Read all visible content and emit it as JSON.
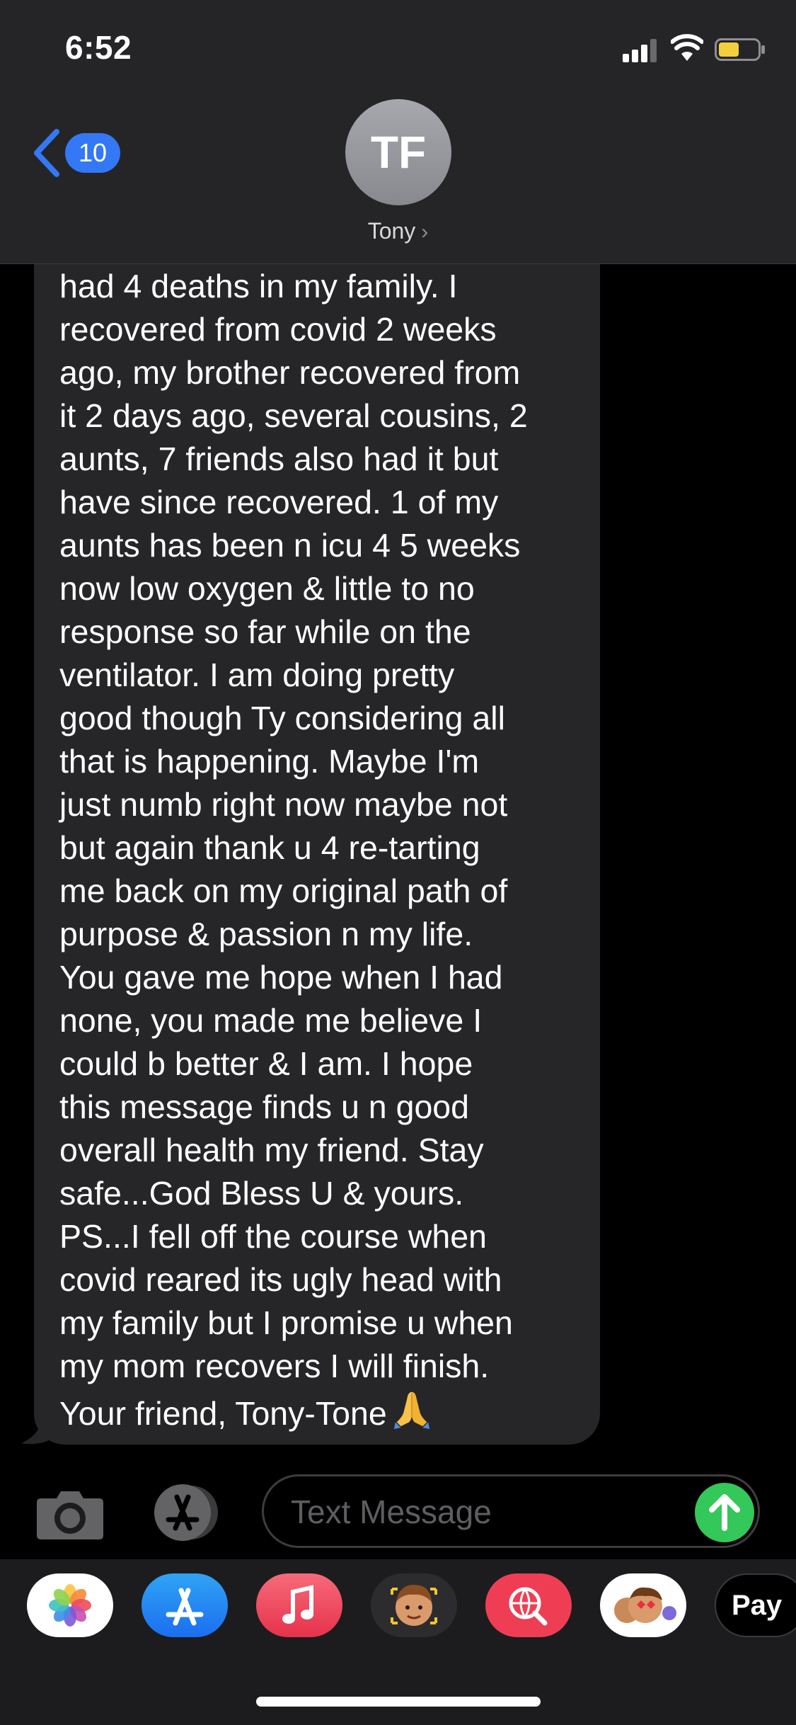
{
  "status_bar": {
    "time": "6:52"
  },
  "header": {
    "back_badge": "10",
    "avatar_initials": "TF",
    "contact_name": "Tony"
  },
  "message": {
    "lines": [
      "had 4 deaths in my family. I",
      "recovered from covid 2 weeks",
      "ago, my brother recovered from",
      "it 2 days ago, several cousins, 2",
      "aunts, 7 friends also had it but",
      "have since recovered. 1 of my",
      "aunts has been n icu 4 5 weeks",
      "now low oxygen & little to no",
      "response so far while on the",
      "ventilator. I am doing pretty",
      "good though Ty considering all",
      "that is happening. Maybe I'm",
      "just numb right now maybe not",
      "but again thank u 4 re-tarting",
      "me back on my original path of",
      "purpose & passion n my life.",
      "You gave me hope when I had",
      "none, you made me believe I",
      "could b better & I am. I hope",
      "this message finds u n good",
      "overall health my friend. Stay",
      "safe...God Bless U & yours.",
      "PS...I fell off the course when",
      "covid reared its ugly head with",
      "my family but I promise u when",
      "my mom recovers I will finish.",
      "Your friend, Tony-Tone"
    ]
  },
  "input": {
    "placeholder": "Text Message"
  },
  "drawer": {
    "apps": [
      "photos-app",
      "app-store-app",
      "music-app",
      "memoji-app",
      "web-images-app",
      "memoji-stickers-app"
    ],
    "apple_pay_label": "Pay"
  },
  "colors": {
    "header_bg": "#252527",
    "bubble_bg": "#262628",
    "accent_blue": "#3478f6",
    "send_green": "#34c759"
  }
}
